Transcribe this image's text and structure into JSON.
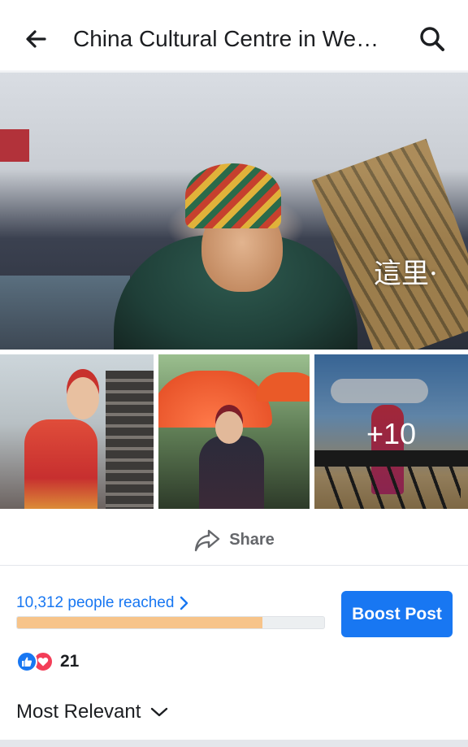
{
  "header": {
    "title": "China Cultural Centre in We…",
    "back_icon": "arrow-left-icon",
    "search_icon": "search-icon"
  },
  "photos": {
    "main_caption": "這里·",
    "more_count": "+10"
  },
  "share": {
    "label": "Share",
    "icon": "share-icon"
  },
  "insights": {
    "reach_label": "10,312 people reached",
    "reach_progress": 0.8,
    "boost_label": "Boost Post"
  },
  "reactions": {
    "icons": [
      "like-icon",
      "love-icon"
    ],
    "count": "21"
  },
  "comments": {
    "sort_label": "Most Relevant"
  },
  "colors": {
    "accent": "#1877f2",
    "progress": "#f7c48a",
    "love": "#f33e58"
  }
}
